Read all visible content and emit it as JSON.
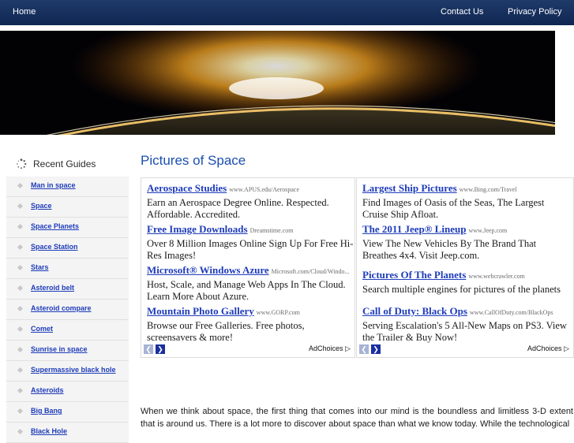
{
  "nav": {
    "home": "Home",
    "contact": "Contact Us",
    "privacy": "Privacy Policy"
  },
  "sidebar": {
    "title": "Recent Guides",
    "items": [
      {
        "label": "Man in space"
      },
      {
        "label": "Space"
      },
      {
        "label": "Space Planets"
      },
      {
        "label": "Space Station"
      },
      {
        "label": "Stars"
      },
      {
        "label": "Asteroid belt"
      },
      {
        "label": "Asteroid compare"
      },
      {
        "label": "Comet"
      },
      {
        "label": "Sunrise in space"
      },
      {
        "label": "Supermassive black hole"
      },
      {
        "label": "Asteroids"
      },
      {
        "label": "Big Bang"
      },
      {
        "label": "Black Hole"
      }
    ]
  },
  "main": {
    "title": "Pictures of Space",
    "body": "When we think about space, the first thing that comes into our mind is the boundless and limitless 3-D extent that is around us. There is a lot more to discover about space than what we know today. While the technological"
  },
  "ads_left": [
    {
      "title": "Aerospace Studies",
      "url": "www.APUS.edu/Aerospace",
      "desc": "Earn an Aerospace Degree Online. Respected. Affordable. Accredited."
    },
    {
      "title": "Free Image Downloads",
      "url": "Dreamstime.com",
      "desc": "Over 8 Million Images Online Sign Up For Free Hi-Res Images!"
    },
    {
      "title": "Microsoft® Windows Azure",
      "url": "Microsoft.com/Cloud/Windo...",
      "desc": "Host, Scale, and Manage Web Apps In The Cloud. Learn More About Azure."
    },
    {
      "title": "Mountain Photo Gallery",
      "url": "www.GORP.com",
      "desc": "Browse our Free Galleries. Free photos, screensavers & more!"
    }
  ],
  "ads_right": [
    {
      "title": "Largest Ship Pictures",
      "url": "www.Bing.com/Travel",
      "desc": "Find Images of Oasis of the Seas, The Largest Cruise Ship Afloat."
    },
    {
      "title": "The 2011 Jeep® Lineup",
      "url": "www.Jeep.com",
      "desc": "View The New Vehicles By The Brand That Breathes 4x4. Visit Jeep.com."
    },
    {
      "title": "Pictures Of The Planets",
      "url": "www.webcrawler.com",
      "desc": "Search multiple engines for pictures of the planets"
    },
    {
      "title": "Call of Duty: Black Ops",
      "url": "www.CallOfDuty.com/BlackOps",
      "desc": "Serving Escalation's 5 All-New Maps on PS3. View the Trailer & Buy Now!"
    }
  ],
  "adchoices": "AdChoices",
  "icons": {
    "prev": "chevron-left-icon",
    "next": "chevron-right-icon",
    "adchoices": "play-triangle-icon",
    "sidebar": "spinner-icon",
    "bullet": "diamond-bullet-icon"
  }
}
